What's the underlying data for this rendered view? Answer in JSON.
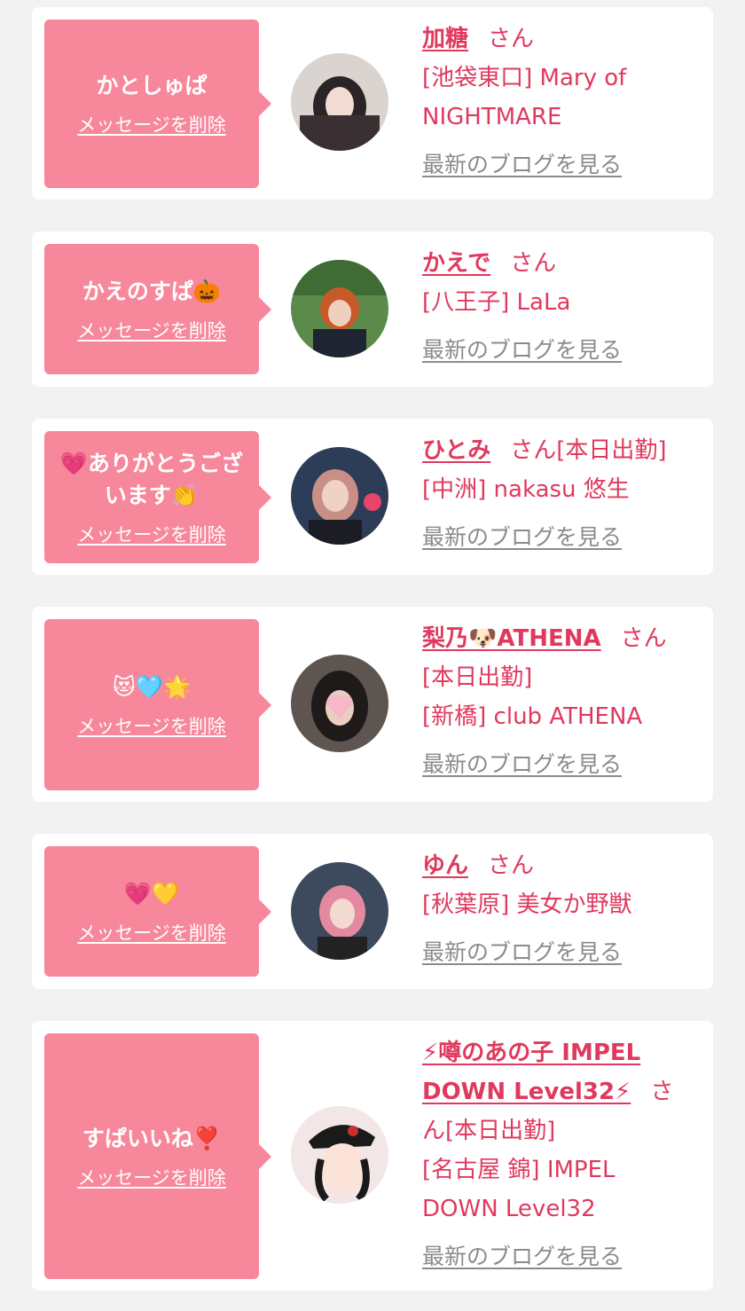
{
  "delete_label": "メッセージを削除",
  "blog_label": "最新のブログを見る",
  "san_label": "さん",
  "cards": [
    {
      "message": "かとしゅぱ",
      "name": "加糖",
      "today": "",
      "location": "[池袋東口] Mary of NIGHTMARE",
      "avatar_colors": [
        "#d9d4d0",
        "#2b2426"
      ]
    },
    {
      "message": "かえのすぱ🎃",
      "name": "かえで",
      "today": "",
      "location": "[八王子] LaLa",
      "avatar_colors": [
        "#5b8a4a",
        "#c85a2a"
      ]
    },
    {
      "message": "💗ありがとうございます👏",
      "name": "ひとみ",
      "today": "[本日出勤]",
      "location": "[中洲] nakasu 悠生",
      "avatar_colors": [
        "#2e3d57",
        "#c98f86"
      ]
    },
    {
      "message": "😻🩵🌟",
      "name": "梨乃🐶ATHENA",
      "today": "[本日出勤]",
      "location": "[新橋] club ATHENA",
      "avatar_colors": [
        "#5e5550",
        "#f5b8c8"
      ]
    },
    {
      "message": "💗💛",
      "name": "ゆん",
      "today": "",
      "location": "[秋葉原] 美女か野獣",
      "avatar_colors": [
        "#3d4a5e",
        "#e48aa0"
      ]
    },
    {
      "message": "すぱいいね❣️",
      "name": "⚡噂のあの子 IMPEL DOWN Level32⚡",
      "today": "[本日出勤]",
      "location": "[名古屋 錦] IMPEL DOWN Level32",
      "avatar_colors": [
        "#f2e6e6",
        "#1a1a1a"
      ]
    }
  ]
}
